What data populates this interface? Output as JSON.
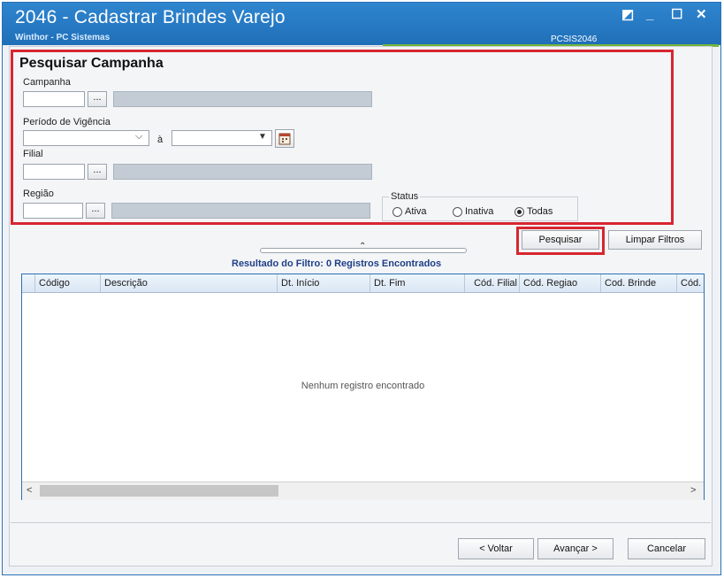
{
  "window": {
    "title": "2046 - Cadastrar Brindes Varejo",
    "subtitle": "Winthor - PC Sistemas",
    "code": "PCSIS2046",
    "controls": [
      "◩",
      "_",
      "☐",
      "✕"
    ]
  },
  "search": {
    "heading": "Pesquisar Campanha",
    "campanha_label": "Campanha",
    "periodo_label": "Período de Vigência",
    "a_label": "à",
    "filial_label": "Filial",
    "regiao_label": "Região",
    "dots_label": "...",
    "status": {
      "label": "Status",
      "options": [
        "Ativa",
        "Inativa",
        "Todas"
      ],
      "selected": "Todas"
    }
  },
  "actions": {
    "pesquisar": "Pesquisar",
    "limpar": "Limpar Filtros"
  },
  "result": {
    "summary": "Resultado do Filtro: 0 Registros Encontrados",
    "columns": [
      "Código",
      "Descrição",
      "Dt. Início",
      "Dt. Fim",
      "Cód. Filial",
      "Cód. Regiao",
      "Cod. Brinde",
      "Cód."
    ],
    "empty_text": "Nenhum registro encontrado"
  },
  "footer": {
    "voltar": "< Voltar",
    "avancar": "Avançar >",
    "cancelar": "Cancelar"
  },
  "colors": {
    "titlebar": "#2f85cf",
    "highlight": "#d7262f",
    "accent_line": "#74b53a"
  }
}
